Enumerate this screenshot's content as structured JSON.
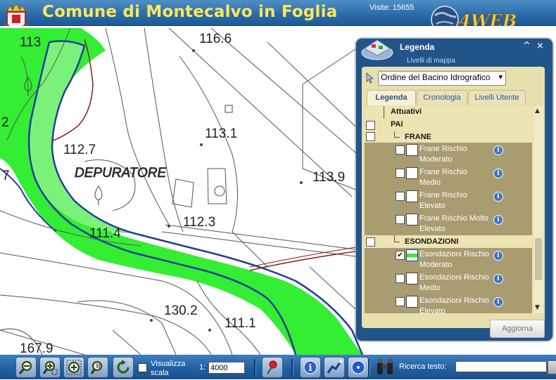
{
  "header": {
    "title": "Comune di Montecalvo in Foglia",
    "visits": "Visite: 15655",
    "logo_text": "4WEB"
  },
  "map": {
    "labels": [
      "116.6",
      "113",
      "2",
      "112.7",
      "7",
      "DEPURATORE",
      "113.1",
      "113.9",
      "112.3",
      "111.4",
      "130.2",
      "111.1",
      "167.9"
    ],
    "colors": {
      "flood_zone": "#33ee33",
      "flood_zone_light": "#7af27a",
      "flood_border": "#243e9c",
      "road_red": "#8b1c1c",
      "base_lines": "#555555"
    }
  },
  "legend": {
    "title": "Legenda",
    "subtitle": "Livelli di mappa",
    "order_select": "Ordine del Bacino Idrografico",
    "tabs": [
      {
        "label": "Legenda",
        "active": true
      },
      {
        "label": "Cronologia",
        "active": false
      },
      {
        "label": "Livelli Utente",
        "active": false
      }
    ],
    "items": [
      {
        "label": "Attuativi",
        "type": "group"
      },
      {
        "label": "PAI",
        "type": "group",
        "checked": false
      },
      {
        "label": "FRANE",
        "type": "group",
        "checked": false
      },
      {
        "label": "Frane Rischio Moderato",
        "type": "layer",
        "checked": false
      },
      {
        "label": "Frane Rischio Medio",
        "type": "layer",
        "checked": false
      },
      {
        "label": "Frane Rischio Elevato",
        "type": "layer",
        "checked": false
      },
      {
        "label": "Frane Rischio Molto Elevato",
        "type": "layer",
        "checked": false
      },
      {
        "label": "ESONDAZIONI",
        "type": "group",
        "checked": false
      },
      {
        "label": "Esondazioni Rischio Moderato",
        "type": "layer",
        "checked": true
      },
      {
        "label": "Esondazioni Rischio Medio",
        "type": "layer",
        "checked": false
      },
      {
        "label": "Esondazioni Rischio Elevato",
        "type": "layer",
        "checked": false
      }
    ],
    "refresh_button": "Aggiorna",
    "info_glyph": "i",
    "minimize_glyph": "^",
    "close_glyph": "×"
  },
  "toolbar": {
    "scale_label": "Visualizza scala",
    "scale_prefix": "1:",
    "scale_value": "4000",
    "search_label": "Ricerca testo:",
    "search_value": ""
  }
}
